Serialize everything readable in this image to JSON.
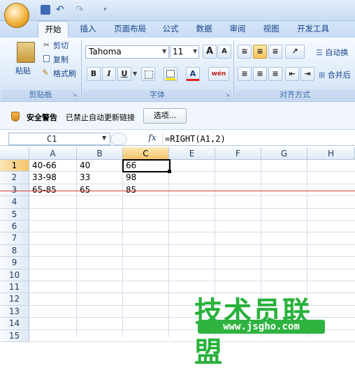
{
  "ribbon": {
    "tabs": [
      {
        "label": "开始",
        "active": true
      },
      {
        "label": "插入"
      },
      {
        "label": "页面布局"
      },
      {
        "label": "公式"
      },
      {
        "label": "数据"
      },
      {
        "label": "审阅"
      },
      {
        "label": "视图"
      },
      {
        "label": "开发工具"
      }
    ],
    "clipboard": {
      "paste": "粘贴",
      "cut": "剪切",
      "copy": "复制",
      "format_painter": "格式刷",
      "group_label": "剪贴板"
    },
    "font": {
      "family": "Tahoma",
      "size": "11",
      "bold": "B",
      "italic": "I",
      "underline": "U",
      "grow": "A",
      "shrink": "A",
      "font_color_letter": "A",
      "phonetic": "wén",
      "group_label": "字体"
    },
    "alignment": {
      "wrap_text": "自动换",
      "merge": "合并后",
      "group_label": "对齐方式"
    }
  },
  "security_bar": {
    "title": "安全警告",
    "message": "已禁止自动更新链接",
    "options_button": "选项..."
  },
  "formula_bar": {
    "name_box": "C1",
    "fx": "fx",
    "formula": "=RIGHT(A1,2)"
  },
  "sheet": {
    "columns": [
      "A",
      "B",
      "C",
      "E",
      "F",
      "G",
      "H"
    ],
    "selected_column": "C",
    "selected_row": "1",
    "row_numbers": [
      "1",
      "2",
      "3",
      "4",
      "5",
      "6",
      "7",
      "8",
      "9",
      "10",
      "11",
      "12",
      "13",
      "14",
      "15"
    ],
    "rows": [
      {
        "A": "40-66",
        "B": "40",
        "C": "66"
      },
      {
        "A": "33-98",
        "B": "33",
        "C": "98"
      },
      {
        "A": "65-85",
        "B": "65",
        "C": "85"
      }
    ]
  },
  "watermark": {
    "brand": "技术员联盟",
    "url": "www.jsgho.com"
  },
  "colors": {
    "accent": "#15428b",
    "selection_header": "#f4c46a",
    "red_line": "#e0393a",
    "watermark": "#27b23a"
  }
}
